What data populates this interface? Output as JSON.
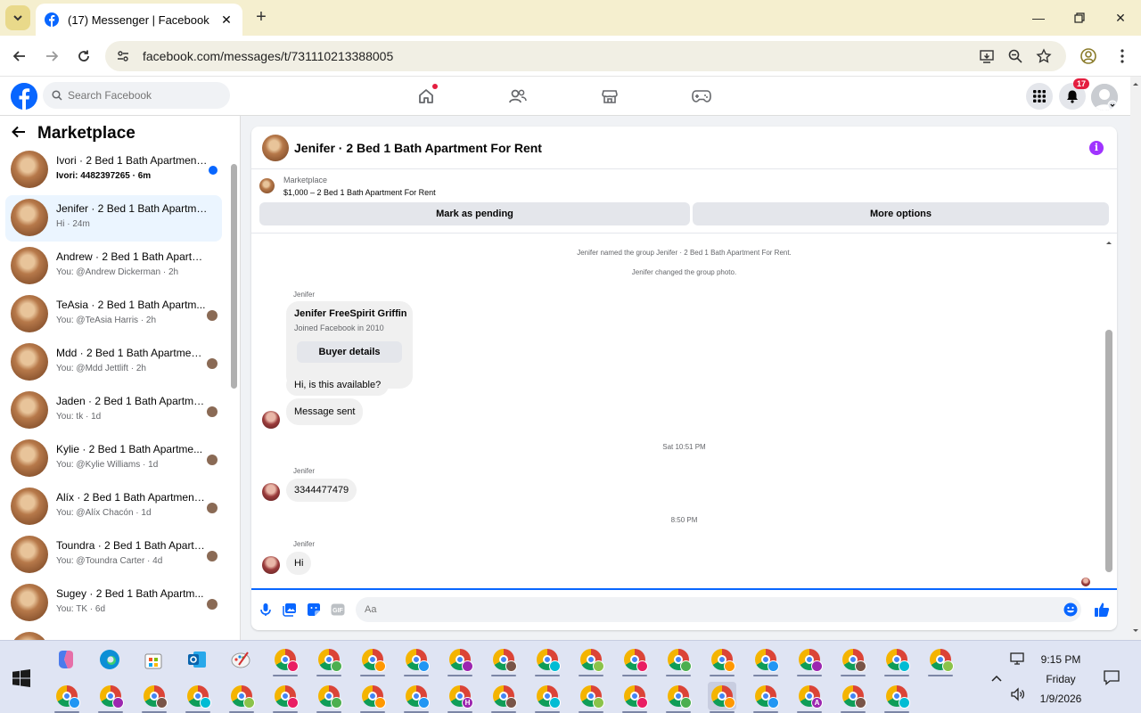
{
  "browser": {
    "tab_title": "(17) Messenger | Facebook",
    "url": "facebook.com/messages/t/731110213388005",
    "tab_icon": "facebook-icon"
  },
  "fb_header": {
    "search_placeholder": "Search Facebook",
    "notification_count": "17",
    "brand_color": "#0866ff"
  },
  "sidebar": {
    "title": "Marketplace",
    "conversations": [
      {
        "title": "Ivori · 2 Bed 1 Bath Apartment...",
        "subtitle": "Ivori: 4482397265 · 6m",
        "unread": true
      },
      {
        "title": "Jenifer · 2 Bed 1 Bath Apartmen...",
        "subtitle": "Hi · 24m",
        "active": true
      },
      {
        "title": "Andrew · 2 Bed 1 Bath Apartme...",
        "subtitle": "You: @Andrew Dickerman · 2h"
      },
      {
        "title": "TeAsia · 2 Bed 1 Bath Apartm...",
        "subtitle": "You: @TeAsia Harris · 2h"
      },
      {
        "title": "Mdd · 2 Bed 1 Bath Apartment ...",
        "subtitle": "You: @Mdd Jettlift · 2h"
      },
      {
        "title": "Jaden · 2 Bed 1 Bath Apartme...",
        "subtitle": "You: tk · 1d"
      },
      {
        "title": "Kylie · 2 Bed 1 Bath Apartme...",
        "subtitle": "You: @Kylie Williams · 1d"
      },
      {
        "title": "Alíx · 2 Bed 1 Bath Apartment F...",
        "subtitle": "You: @Alíx Chacón · 1d"
      },
      {
        "title": "Toundra · 2 Bed 1 Bath Apartme...",
        "subtitle": "You: @Toundra Carter · 4d"
      },
      {
        "title": "Sugey · 2 Bed 1 Bath Apartm...",
        "subtitle": "You: TK · 6d"
      }
    ]
  },
  "chat": {
    "title": "Jenifer · 2 Bed 1 Bath Apartment For Rent",
    "listing": {
      "source": "Marketplace",
      "price_title": "$1,000 – 2 Bed 1 Bath Apartment For Rent",
      "mark_pending": "Mark as pending",
      "more_options": "More options"
    },
    "system_messages": [
      "Jenifer named the group Jenifer · 2 Bed 1 Bath Apartment For Rent.",
      "Jenifer changed the group photo."
    ],
    "sender": "Jenifer",
    "buyer_card": {
      "name": "Jenifer FreeSpirit Griffin",
      "joined": "Joined Facebook in 2010",
      "button": "Buyer details"
    },
    "messages": [
      "Hi, is this available?",
      "Message sent",
      "3344477479",
      "Hi"
    ],
    "timestamps": [
      "Sat 10:51 PM",
      "8:50 PM"
    ],
    "composer_placeholder": "Aa"
  },
  "taskbar": {
    "time": "9:15 PM",
    "day": "Friday",
    "date": "1/9/2026"
  }
}
